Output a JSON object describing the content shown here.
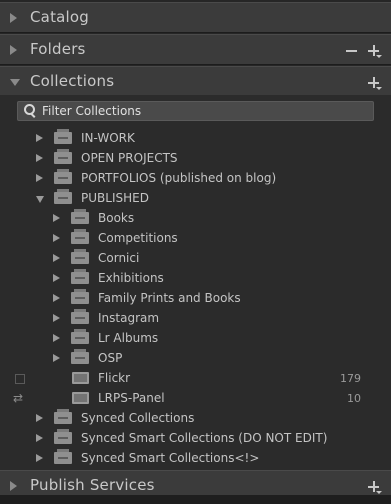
{
  "panels": {
    "catalog": {
      "title": "Catalog"
    },
    "folders": {
      "title": "Folders"
    },
    "collections": {
      "title": "Collections"
    },
    "publish_services": {
      "title": "Publish Services"
    }
  },
  "filter": {
    "placeholder": "Filter Collections"
  },
  "tree": [
    {
      "label": "IN-WORK",
      "type": "set",
      "expanded": false,
      "level": 1
    },
    {
      "label": "OPEN PROJECTS",
      "type": "set",
      "expanded": false,
      "level": 1
    },
    {
      "label": "PORTFOLIOS (published on blog)",
      "type": "set",
      "expanded": false,
      "level": 1
    },
    {
      "label": "PUBLISHED",
      "type": "set",
      "expanded": true,
      "level": 1
    },
    {
      "label": "Books",
      "type": "set",
      "expanded": false,
      "level": 2
    },
    {
      "label": "Competitions",
      "type": "set",
      "expanded": false,
      "level": 2
    },
    {
      "label": "Cornici",
      "type": "set",
      "expanded": false,
      "level": 2
    },
    {
      "label": "Exhibitions",
      "type": "set",
      "expanded": false,
      "level": 2
    },
    {
      "label": "Family Prints and Books",
      "type": "set",
      "expanded": false,
      "level": 2
    },
    {
      "label": "Instagram",
      "type": "set",
      "expanded": false,
      "level": 2
    },
    {
      "label": "Lr Albums",
      "type": "set",
      "expanded": false,
      "level": 2
    },
    {
      "label": "OSP",
      "type": "set",
      "expanded": false,
      "level": 2
    },
    {
      "label": "Flickr",
      "type": "collection",
      "count": "179",
      "marker": "checkbox",
      "level": 2
    },
    {
      "label": "LRPS-Panel",
      "type": "collection",
      "count": "10",
      "marker": "sync-icon",
      "level": 2
    },
    {
      "label": "Synced Collections",
      "type": "set",
      "expanded": false,
      "level": 1
    },
    {
      "label": "Synced Smart Collections (DO NOT EDIT)",
      "type": "set",
      "expanded": false,
      "level": 1
    },
    {
      "label": "Synced Smart Collections<!>",
      "type": "set",
      "expanded": false,
      "level": 1
    }
  ]
}
